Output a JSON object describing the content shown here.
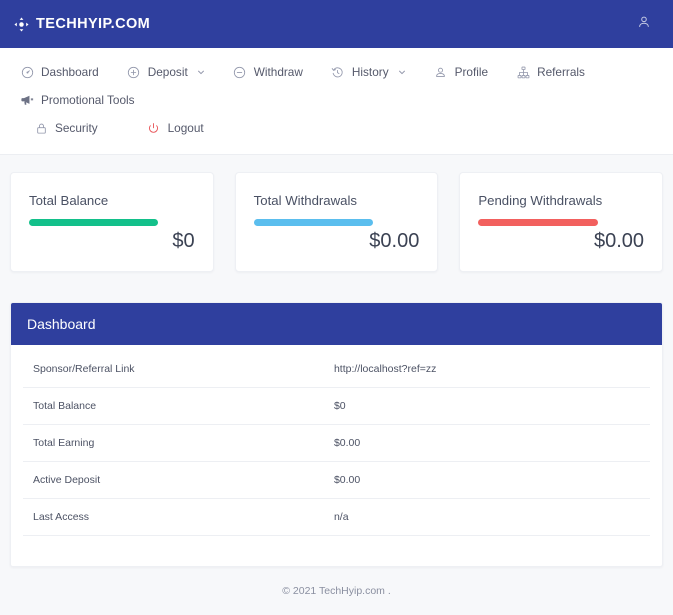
{
  "topbar": {
    "brand": "TECHHYIP.COM",
    "brand_icon": "move-crosshair-icon",
    "user_icon": "user-icon",
    "background": "#2f3f9e"
  },
  "nav": {
    "items": [
      {
        "label": "Dashboard",
        "icon": "dashboard-circle-icon",
        "caret": false
      },
      {
        "label": "Deposit",
        "icon": "plus-circle-icon",
        "caret": true
      },
      {
        "label": "Withdraw",
        "icon": "minus-circle-icon",
        "caret": false
      },
      {
        "label": "History",
        "icon": "clock-history-icon",
        "caret": true
      },
      {
        "label": "Profile",
        "icon": "person-icon",
        "caret": false
      },
      {
        "label": "Referrals",
        "icon": "network-diagram-icon",
        "caret": false
      },
      {
        "label": "Promotional Tools",
        "icon": "megaphone-icon",
        "caret": false
      },
      {
        "label": "Security",
        "icon": "lock-icon",
        "caret": false
      },
      {
        "label": "Logout",
        "icon": "power-icon",
        "caret": false,
        "danger": true
      }
    ]
  },
  "cards": [
    {
      "title": "Total Balance",
      "value": "$0",
      "color": "#13c08a",
      "fill_percent": 78
    },
    {
      "title": "Total Withdrawals",
      "value": "$0.00",
      "color": "#5bbeee",
      "fill_percent": 72
    },
    {
      "title": "Pending Withdrawals",
      "value": "$0.00",
      "color": "#f2605e",
      "fill_percent": 72
    }
  ],
  "panel": {
    "title": "Dashboard",
    "rows": [
      {
        "key": "Sponsor/Referral Link",
        "value": "http://localhost?ref=zz"
      },
      {
        "key": "Total Balance",
        "value": "$0"
      },
      {
        "key": "Total Earning",
        "value": "$0.00"
      },
      {
        "key": "Active Deposit",
        "value": "$0.00"
      },
      {
        "key": "Last Access",
        "value": "n/a"
      }
    ]
  },
  "footer": {
    "text": "© 2021 TechHyip.com ."
  }
}
